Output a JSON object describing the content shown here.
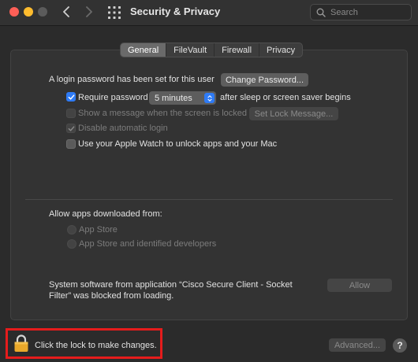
{
  "window": {
    "title": "Security & Privacy"
  },
  "search": {
    "placeholder": "Search"
  },
  "tabs": [
    {
      "label": "General",
      "active": true
    },
    {
      "label": "FileVault",
      "active": false
    },
    {
      "label": "Firewall",
      "active": false
    },
    {
      "label": "Privacy",
      "active": false
    }
  ],
  "general": {
    "login_text": "A login password has been set for this user",
    "change_password_label": "Change Password...",
    "require_password_label": "Require password",
    "require_password_checked": true,
    "require_password_interval": "5 minutes",
    "after_sleep_text": "after sleep or screen saver begins",
    "show_message_label": "Show a message when the screen is locked",
    "show_message_checked": false,
    "set_lock_message_label": "Set Lock Message...",
    "disable_auto_login_label": "Disable automatic login",
    "disable_auto_login_checked": true,
    "apple_watch_label": "Use your Apple Watch to unlock apps and your Mac",
    "apple_watch_checked": false,
    "allow_apps_heading": "Allow apps downloaded from:",
    "radio_app_store": "App Store",
    "radio_app_store_identified": "App Store and identified developers",
    "blocked_text_line1": "System software from application “Cisco Secure Client - Socket",
    "blocked_text_line2": "Filter” was blocked from loading.",
    "allow_label": "Allow"
  },
  "footer": {
    "lock_text": "Click the lock to make changes.",
    "advanced_label": "Advanced...",
    "help_label": "?"
  },
  "colors": {
    "accent": "#2e7bf6",
    "highlight_box": "#e51c1c",
    "lock_gold": "#e9a82a"
  },
  "icons": [
    "back-chevron-icon",
    "forward-chevron-icon",
    "grid-icon",
    "search-icon",
    "checkmark-icon",
    "lock-icon",
    "stepper-icon"
  ]
}
